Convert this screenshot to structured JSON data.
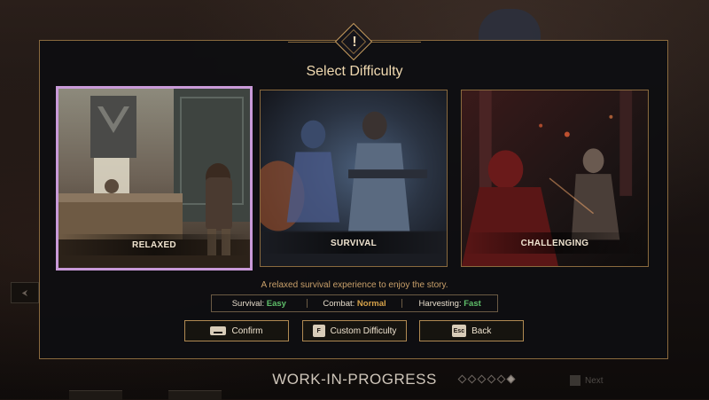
{
  "dialog": {
    "title": "Select Difficulty",
    "badge_icon": "exclamation-icon",
    "badge_glyph": "!"
  },
  "cards": [
    {
      "label": "RELAXED",
      "selected": true
    },
    {
      "label": "SURVIVAL",
      "selected": false
    },
    {
      "label": "CHALLENGING",
      "selected": false
    }
  ],
  "description": "A relaxed survival experience to enjoy the story.",
  "stats": [
    {
      "label": "Survival:",
      "value": "Easy",
      "color": "#5fbf6a"
    },
    {
      "label": "Combat:",
      "value": "Normal",
      "color": "#d6a24a"
    },
    {
      "label": "Harvesting:",
      "value": "Fast",
      "color": "#5fbf6a"
    }
  ],
  "buttons": {
    "confirm": {
      "label": "Confirm",
      "key_icon": "spacebar-icon"
    },
    "custom": {
      "label": "Custom Difficulty",
      "key": "F"
    },
    "back": {
      "label": "Back",
      "key": "Esc"
    }
  },
  "footer": {
    "wip": "WORK-IN-PROGRESS",
    "page_count": 6,
    "current_page": 6,
    "next_label": "Next"
  },
  "colors": {
    "accent_gold": "#c49a5c",
    "selected_border": "#c99ad8"
  }
}
